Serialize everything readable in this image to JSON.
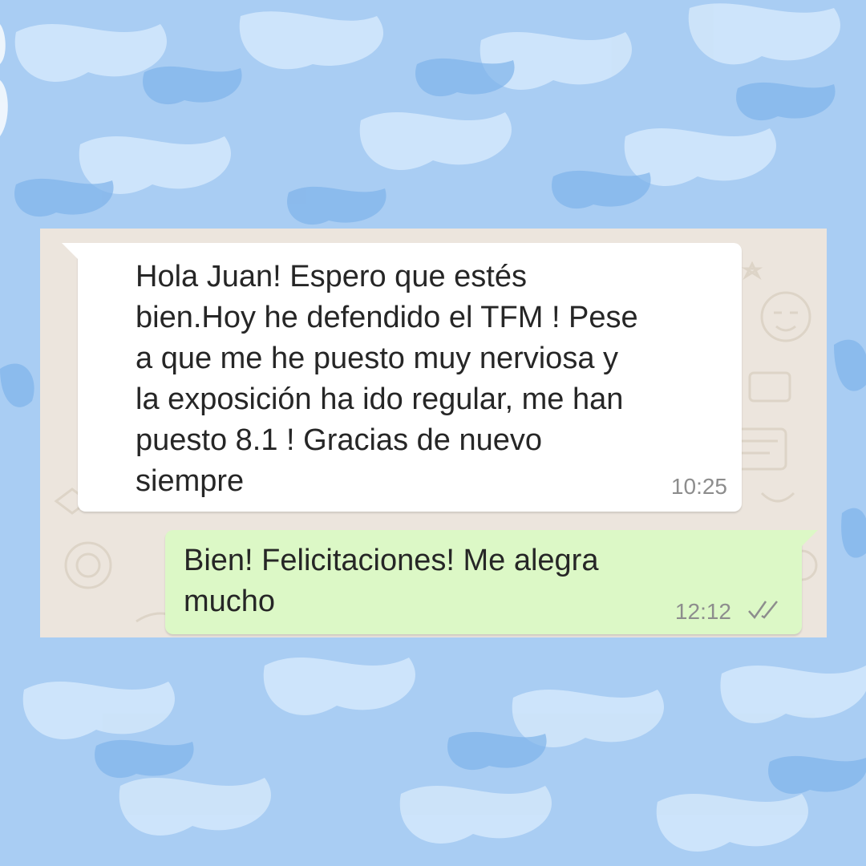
{
  "colors": {
    "background": "#a9cdf3",
    "chat_background": "#ece5dd",
    "incoming_bubble": "#ffffff",
    "outgoing_bubble": "#dcf8c6",
    "text": "#262626",
    "timestamp": "#8d8d8d"
  },
  "messages": [
    {
      "direction": "incoming",
      "lines": [
        "Hola Juan! Espero que estés",
        "bien.Hoy he defendido el TFM ! Pese",
        "a que me he puesto muy nerviosa y",
        "la exposición ha ido regular, me han",
        "puesto 8.1 ! Gracias de nuevo",
        "siempre"
      ],
      "time": "10:25"
    },
    {
      "direction": "outgoing",
      "lines": [
        "Bien! Felicitaciones! Me alegra",
        "mucho"
      ],
      "time": "12:12",
      "status_icon": "double-check-icon"
    }
  ]
}
